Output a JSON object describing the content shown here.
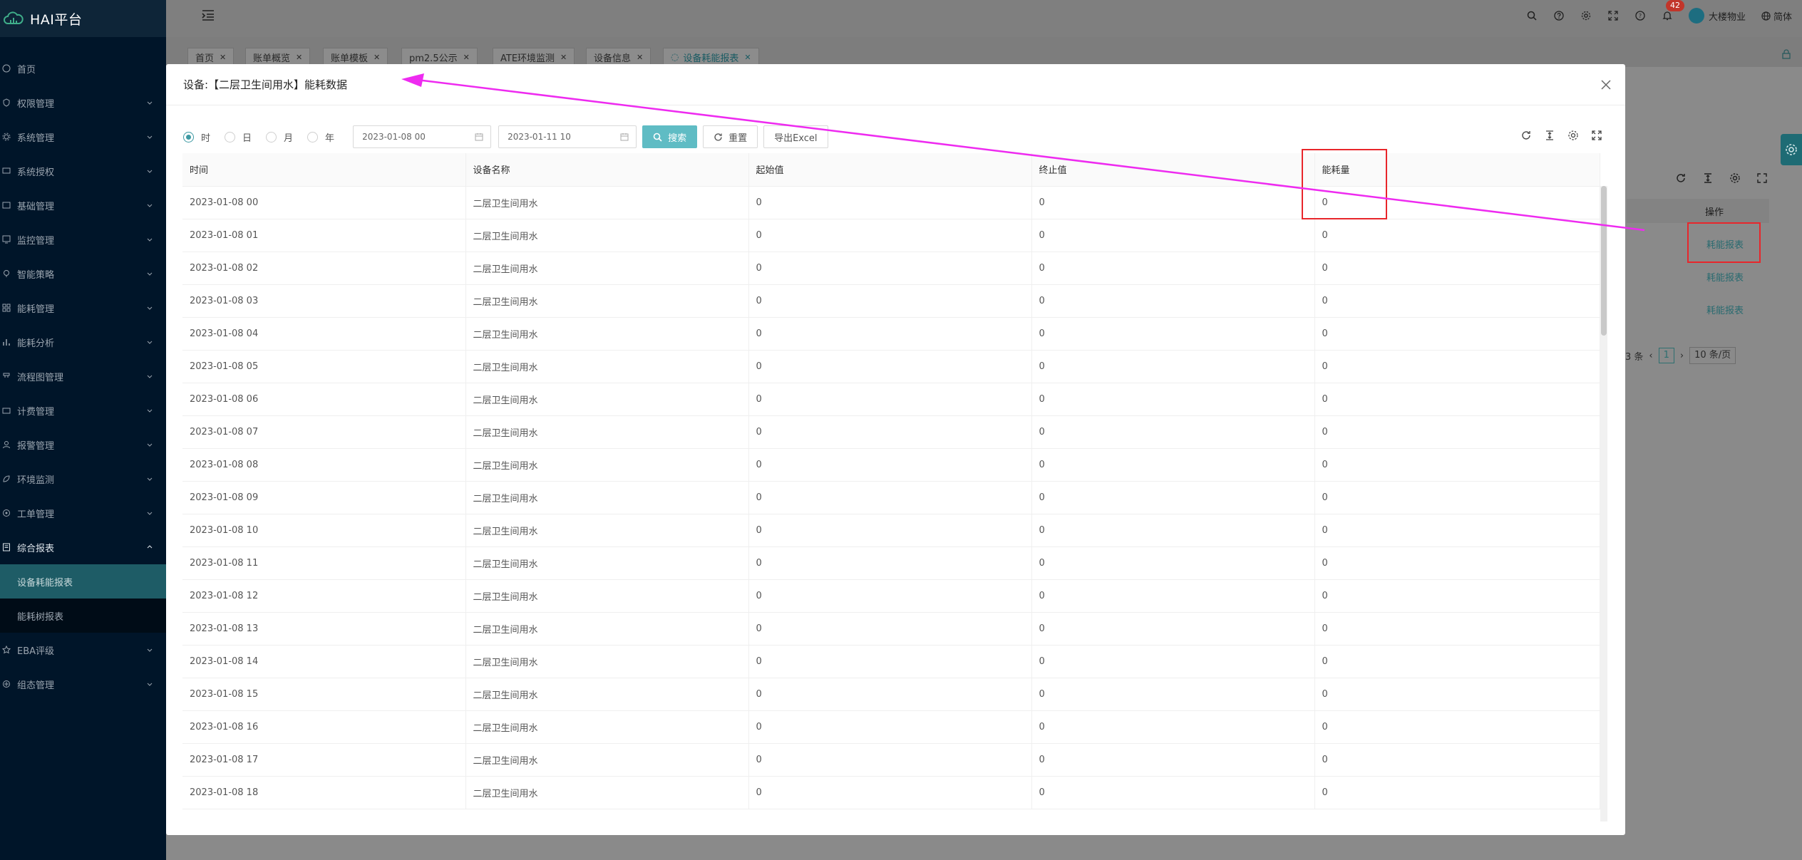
{
  "app": {
    "title": "HAI平台"
  },
  "sidebar": {
    "items": [
      {
        "label": "首页"
      },
      {
        "label": "权限管理"
      },
      {
        "label": "系统管理"
      },
      {
        "label": "系统授权"
      },
      {
        "label": "基础管理"
      },
      {
        "label": "监控管理"
      },
      {
        "label": "智能策略"
      },
      {
        "label": "能耗管理"
      },
      {
        "label": "能耗分析"
      },
      {
        "label": "流程图管理"
      },
      {
        "label": "计费管理"
      },
      {
        "label": "报警管理"
      },
      {
        "label": "环境监测"
      },
      {
        "label": "工单管理"
      },
      {
        "label": "综合报表"
      }
    ],
    "sub_items": [
      {
        "label": "设备耗能报表"
      },
      {
        "label": "能耗树报表"
      }
    ],
    "items_after": [
      {
        "label": "EBA评级"
      },
      {
        "label": "组态管理"
      }
    ]
  },
  "header": {
    "notification_count": "42",
    "user_name": "大楼物业",
    "language": "简体"
  },
  "tabs": [
    {
      "label": "首页"
    },
    {
      "label": "账单概览"
    },
    {
      "label": "账单模板"
    },
    {
      "label": "pm2.5公示"
    },
    {
      "label": "ATE环境监测"
    },
    {
      "label": "设备信息"
    },
    {
      "label": "设备耗能报表"
    }
  ],
  "background_page": {
    "op_column": "操作",
    "links": [
      "耗能报表",
      "耗能报表",
      "耗能报表"
    ],
    "pager_total": "3 条",
    "pager_current": "1",
    "pager_size": "10 条/页"
  },
  "modal": {
    "title": "设备:【二层卫生间用水】能耗数据",
    "radios": [
      {
        "label": "时",
        "checked": true
      },
      {
        "label": "日",
        "checked": false
      },
      {
        "label": "月",
        "checked": false
      },
      {
        "label": "年",
        "checked": false
      }
    ],
    "start_date": "2023-01-08 00",
    "end_date": "2023-01-11 10",
    "search_label": "搜索",
    "reset_label": "重置",
    "export_label": "导出Excel",
    "columns": [
      "时间",
      "设备名称",
      "起始值",
      "终止值",
      "能耗量"
    ],
    "rows": [
      [
        "2023-01-08 00",
        "二层卫生间用水",
        "0",
        "0",
        "0"
      ],
      [
        "2023-01-08 01",
        "二层卫生间用水",
        "0",
        "0",
        "0"
      ],
      [
        "2023-01-08 02",
        "二层卫生间用水",
        "0",
        "0",
        "0"
      ],
      [
        "2023-01-08 03",
        "二层卫生间用水",
        "0",
        "0",
        "0"
      ],
      [
        "2023-01-08 04",
        "二层卫生间用水",
        "0",
        "0",
        "0"
      ],
      [
        "2023-01-08 05",
        "二层卫生间用水",
        "0",
        "0",
        "0"
      ],
      [
        "2023-01-08 06",
        "二层卫生间用水",
        "0",
        "0",
        "0"
      ],
      [
        "2023-01-08 07",
        "二层卫生间用水",
        "0",
        "0",
        "0"
      ],
      [
        "2023-01-08 08",
        "二层卫生间用水",
        "0",
        "0",
        "0"
      ],
      [
        "2023-01-08 09",
        "二层卫生间用水",
        "0",
        "0",
        "0"
      ],
      [
        "2023-01-08 10",
        "二层卫生间用水",
        "0",
        "0",
        "0"
      ],
      [
        "2023-01-08 11",
        "二层卫生间用水",
        "0",
        "0",
        "0"
      ],
      [
        "2023-01-08 12",
        "二层卫生间用水",
        "0",
        "0",
        "0"
      ],
      [
        "2023-01-08 13",
        "二层卫生间用水",
        "0",
        "0",
        "0"
      ],
      [
        "2023-01-08 14",
        "二层卫生间用水",
        "0",
        "0",
        "0"
      ],
      [
        "2023-01-08 15",
        "二层卫生间用水",
        "0",
        "0",
        "0"
      ],
      [
        "2023-01-08 16",
        "二层卫生间用水",
        "0",
        "0",
        "0"
      ],
      [
        "2023-01-08 17",
        "二层卫生间用水",
        "0",
        "0",
        "0"
      ],
      [
        "2023-01-08 18",
        "二层卫生间用水",
        "0",
        "0",
        "0"
      ]
    ]
  },
  "colors": {
    "sidebar_bg": "#001529",
    "primary": "#5fbcc4",
    "annotation_box": "#e8262b",
    "annotation_arrow": "#ee2bf0"
  }
}
